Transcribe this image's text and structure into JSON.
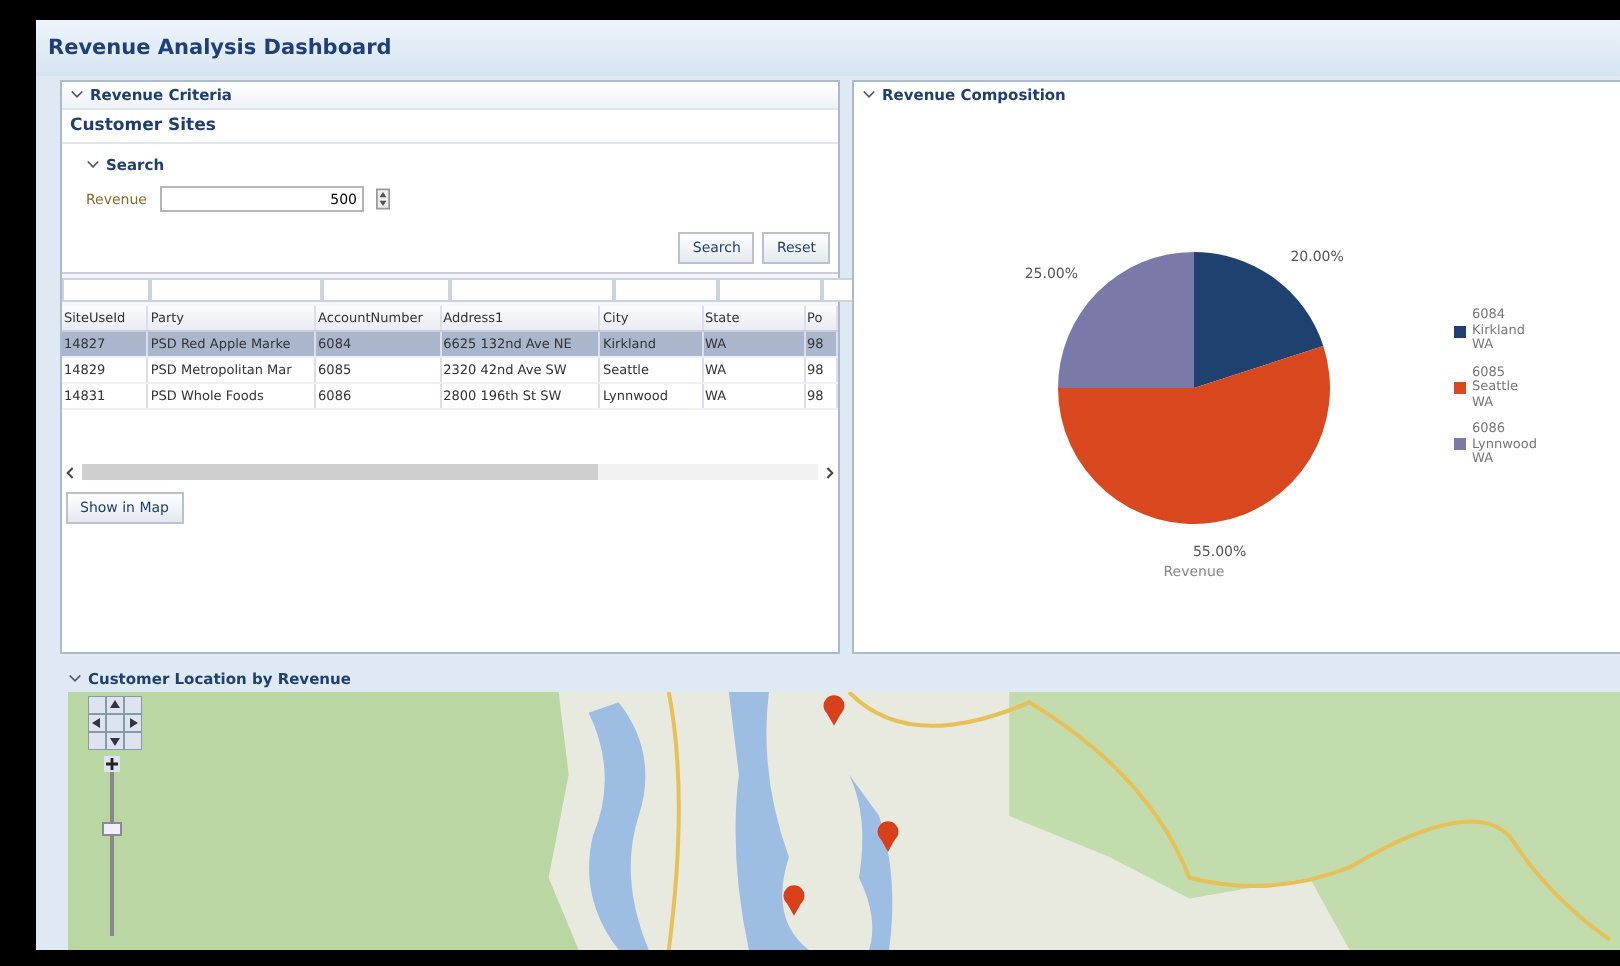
{
  "header": {
    "title": "Revenue Analysis Dashboard"
  },
  "criteria_panel": {
    "title": "Revenue Criteria",
    "expanded": true,
    "section_title": "Customer Sites",
    "search": {
      "title": "Search",
      "expanded": true,
      "field_label": "Revenue",
      "field_value": "500",
      "buttons": [
        "Search",
        "Reset"
      ]
    },
    "table": {
      "columns": [
        "SiteUseId",
        "Party",
        "AccountNumber",
        "Address1",
        "City",
        "State",
        "Po"
      ],
      "rows": [
        {
          "selected": true,
          "cells": [
            "14827",
            "PSD Red Apple Marke",
            "6084",
            "6625 132nd Ave NE",
            "Kirkland",
            "WA",
            "98"
          ]
        },
        {
          "selected": false,
          "cells": [
            "14829",
            "PSD Metropolitan Mar",
            "6085",
            "2320 42nd Ave SW",
            "Seattle",
            "WA",
            "98"
          ]
        },
        {
          "selected": false,
          "cells": [
            "14831",
            "PSD Whole Foods",
            "6086",
            "2800 196th St SW",
            "Lynnwood",
            "WA",
            "98"
          ]
        }
      ]
    },
    "show_button": "Show in Map"
  },
  "composition_panel": {
    "title": "Revenue Composition",
    "expanded": true,
    "chart_data": {
      "type": "pie",
      "xlabel": "Revenue",
      "categories": [
        "6084 Kirkland WA",
        "6085 Seattle WA",
        "6086 Lynnwood WA"
      ],
      "values": [
        20,
        55,
        25
      ],
      "legend": "right",
      "colors": [
        "#1f416f",
        "#d9471f",
        "#7b79a8"
      ],
      "value_labels": [
        "20.00%",
        "55.00%",
        "25.00%"
      ]
    }
  },
  "map_panel": {
    "title": "Customer Location by Revenue",
    "expanded": true,
    "zoom_slider": {
      "level": 0.7
    }
  }
}
